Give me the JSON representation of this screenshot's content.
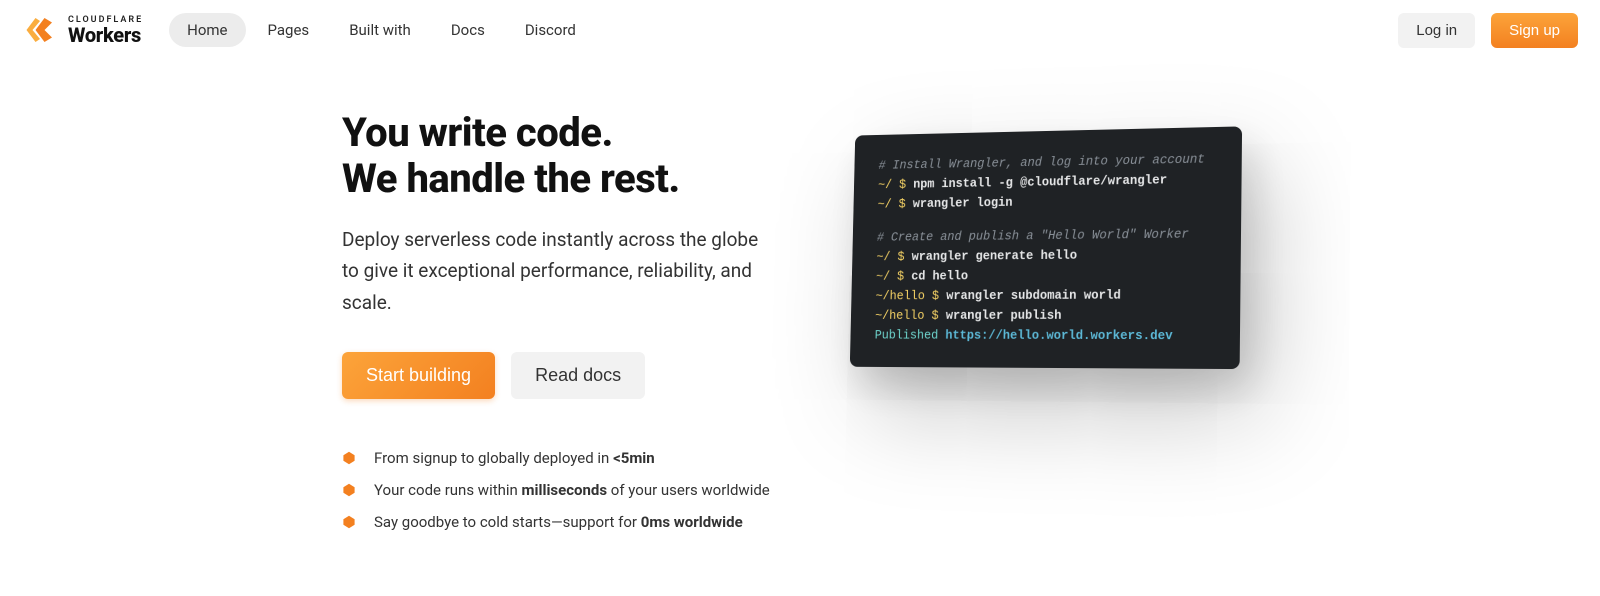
{
  "brand": {
    "small": "CLOUDFLARE",
    "large": "Workers"
  },
  "nav": {
    "items": [
      {
        "label": "Home",
        "active": true
      },
      {
        "label": "Pages",
        "active": false
      },
      {
        "label": "Built with",
        "active": false
      },
      {
        "label": "Docs",
        "active": false
      },
      {
        "label": "Discord",
        "active": false
      }
    ],
    "login": "Log in",
    "signup": "Sign up"
  },
  "hero": {
    "headline_line1": "You write code.",
    "headline_line2": "We handle the rest.",
    "subhead": "Deploy serverless code instantly across the globe to give it exceptional performance, reliability, and scale.",
    "cta_primary": "Start building",
    "cta_secondary": "Read docs"
  },
  "features": [
    {
      "pre": "From signup to globally deployed in ",
      "bold": "<5min",
      "post": ""
    },
    {
      "pre": "Your code runs within ",
      "bold": "milliseconds",
      "post": " of your users worldwide"
    },
    {
      "pre": "Say goodbye to cold starts—support for ",
      "bold": "0ms worldwide",
      "post": ""
    }
  ],
  "terminal": {
    "block1_comment": "# Install Wrangler, and log into your account",
    "block1_lines": [
      {
        "path": "~/",
        "cmd": "npm install -g @cloudflare/wrangler"
      },
      {
        "path": "~/",
        "cmd": "wrangler login"
      }
    ],
    "block2_comment": "# Create and publish a \"Hello World\" Worker",
    "block2_lines": [
      {
        "path": "~/",
        "cmd": "wrangler generate hello"
      },
      {
        "path": "~/",
        "cmd": "cd hello"
      },
      {
        "path": "~/hello",
        "cmd": "wrangler subdomain world"
      },
      {
        "path": "~/hello",
        "cmd": "wrangler publish"
      }
    ],
    "published_label": "Published",
    "published_url": "https://hello.world.workers.dev"
  }
}
